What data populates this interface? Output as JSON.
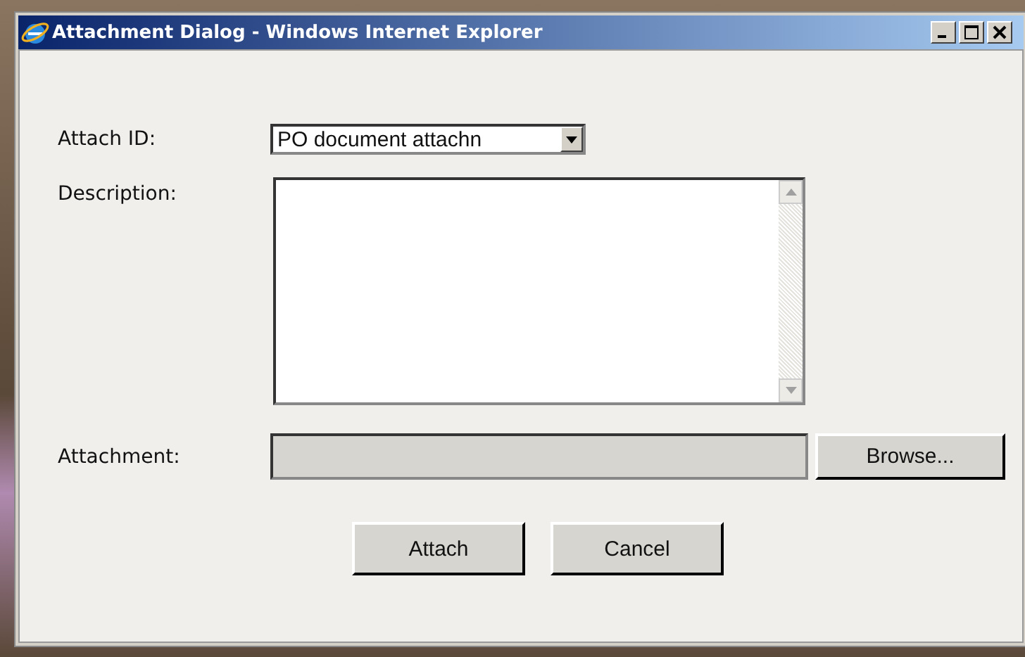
{
  "window": {
    "title": "Attachment Dialog - Windows Internet Explorer"
  },
  "form": {
    "attach_id": {
      "label": "Attach ID:",
      "value": "PO document attachn"
    },
    "description": {
      "label": "Description:"
    },
    "attachment": {
      "label": "Attachment:",
      "disabled": true,
      "button": "Browse..."
    }
  },
  "buttons": [
    "Attach",
    "Cancel"
  ]
}
